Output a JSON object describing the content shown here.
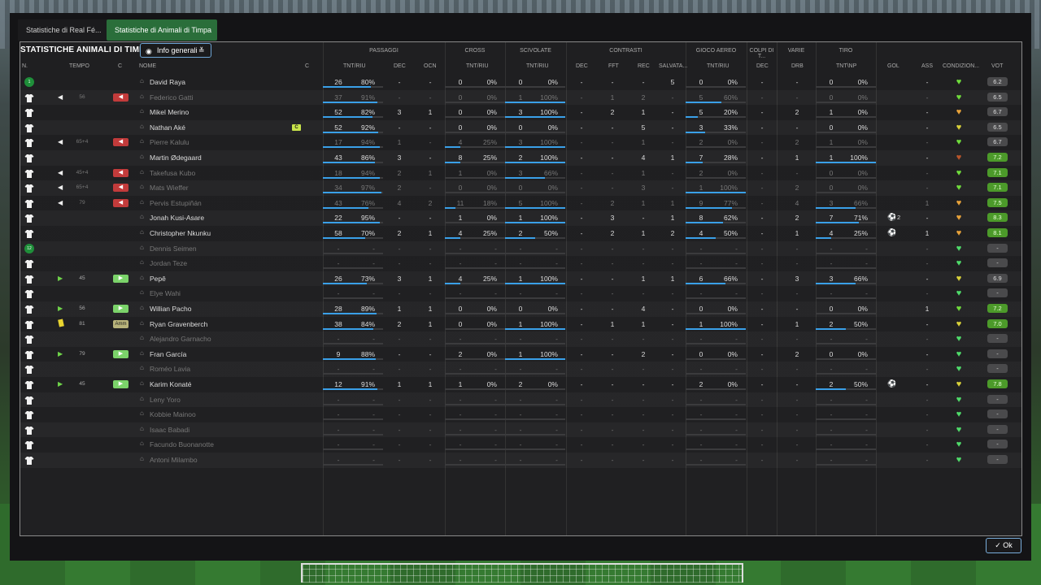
{
  "tabs": [
    {
      "label": "Statistiche di Real Fé..."
    },
    {
      "label": "Statistiche di Animali di Timpa"
    }
  ],
  "title": "STATISTICHE ANIMALI DI TIMPA",
  "view_dropdown": {
    "label": "Info generali"
  },
  "groups": {
    "passaggi": "PASSAGGI",
    "cross": "CROSS",
    "scivolate": "SCIVOLATE",
    "contrasti": "CONTRASTI",
    "gioco_aereo": "GIOCO AEREO",
    "colpi_di_testa": "COLPI DI T...",
    "varie": "VARIE",
    "tiro": "TIRO"
  },
  "columns": {
    "n": "N.",
    "tempo": "TEMPO",
    "c": "C",
    "nome": "NOME",
    "c2": "C",
    "pass_tnt": "TNT/RIU",
    "pass_dec": "DEC",
    "pass_ocn": "OCN",
    "cross_tnt": "TNT/RIU",
    "sciv_tnt": "TNT/RIU",
    "contr_dec": "DEC",
    "contr_fft": "FFT",
    "contr_rec": "REC",
    "contr_salv": "SALVATA...",
    "aereo_tnt": "TNT/RIU",
    "testa_dec": "DEC",
    "varie_drb": "DRB",
    "tiro_tnt": "TNT\\NP",
    "gol": "GOL",
    "ass": "ASS",
    "condizione": "CONDIZION...",
    "vot": "VOT"
  },
  "players": [
    {
      "num": "1",
      "gk": true,
      "tempo": "",
      "sub": "",
      "name": "David Raya",
      "dim": false,
      "cap": false,
      "p": "26",
      "pp": "80%",
      "pf": 0.8,
      "dec": "-",
      "ocn": "-",
      "cr": "0",
      "crp": "0%",
      "crf": 0,
      "sc": "0",
      "scp": "0%",
      "scf": 0,
      "cd": "-",
      "cf": "-",
      "cr2": "-",
      "cs": "5",
      "ae": "0",
      "aep": "0%",
      "aef": 0,
      "td": "-",
      "drb": "-",
      "ti": "0",
      "tip": "0%",
      "tif": 0,
      "gol": "",
      "golx": "",
      "ass": "-",
      "heart": "#6fdc3c",
      "vot": "6.2",
      "votg": false
    },
    {
      "num": "",
      "gk": false,
      "tempo": "56",
      "sub": "out",
      "name": "Federico Gatti",
      "dim": true,
      "cap": false,
      "p": "37",
      "pp": "91%",
      "pf": 0.91,
      "dec": "-",
      "ocn": "-",
      "cr": "0",
      "crp": "0%",
      "crf": 0,
      "sc": "1",
      "scp": "100%",
      "scf": 1,
      "cd": "-",
      "cf": "1",
      "cr2": "2",
      "cs": "-",
      "ae": "5",
      "aep": "60%",
      "aef": 0.6,
      "td": "-",
      "drb": "-",
      "ti": "0",
      "tip": "0%",
      "tif": 0,
      "gol": "",
      "golx": "",
      "ass": "-",
      "heart": "#6fdc3c",
      "vot": "6.5",
      "votg": false
    },
    {
      "num": "",
      "gk": false,
      "tempo": "",
      "sub": "",
      "name": "Mikel Merino",
      "dim": false,
      "cap": false,
      "p": "52",
      "pp": "82%",
      "pf": 0.82,
      "dec": "3",
      "ocn": "1",
      "cr": "0",
      "crp": "0%",
      "crf": 0,
      "sc": "3",
      "scp": "100%",
      "scf": 1,
      "cd": "-",
      "cf": "2",
      "cr2": "1",
      "cs": "-",
      "ae": "5",
      "aep": "20%",
      "aef": 0.2,
      "td": "-",
      "drb": "2",
      "ti": "1",
      "tip": "0%",
      "tif": 0,
      "gol": "",
      "golx": "",
      "ass": "-",
      "heart": "#e8a23a",
      "vot": "6.7",
      "votg": false
    },
    {
      "num": "",
      "gk": false,
      "tempo": "",
      "sub": "",
      "name": "Nathan Aké",
      "dim": false,
      "cap": true,
      "p": "52",
      "pp": "92%",
      "pf": 0.92,
      "dec": "-",
      "ocn": "-",
      "cr": "0",
      "crp": "0%",
      "crf": 0,
      "sc": "0",
      "scp": "0%",
      "scf": 0,
      "cd": "-",
      "cf": "-",
      "cr2": "5",
      "cs": "-",
      "ae": "3",
      "aep": "33%",
      "aef": 0.33,
      "td": "-",
      "drb": "-",
      "ti": "0",
      "tip": "0%",
      "tif": 0,
      "gol": "",
      "golx": "",
      "ass": "-",
      "heart": "#d9d23a",
      "vot": "6.5",
      "votg": false
    },
    {
      "num": "",
      "gk": false,
      "tempo": "65+4",
      "sub": "out",
      "name": "Pierre Kalulu",
      "dim": true,
      "cap": false,
      "p": "17",
      "pp": "94%",
      "pf": 0.94,
      "dec": "1",
      "ocn": "-",
      "cr": "4",
      "crp": "25%",
      "crf": 0.25,
      "sc": "3",
      "scp": "100%",
      "scf": 1,
      "cd": "-",
      "cf": "-",
      "cr2": "1",
      "cs": "-",
      "ae": "2",
      "aep": "0%",
      "aef": 0,
      "td": "-",
      "drb": "2",
      "ti": "1",
      "tip": "0%",
      "tif": 0,
      "gol": "",
      "golx": "",
      "ass": "-",
      "heart": "#6fdc3c",
      "vot": "6.7",
      "votg": false
    },
    {
      "num": "",
      "gk": false,
      "tempo": "",
      "sub": "",
      "name": "Martin Ødegaard",
      "dim": false,
      "cap": false,
      "p": "43",
      "pp": "86%",
      "pf": 0.86,
      "dec": "3",
      "ocn": "-",
      "cr": "8",
      "crp": "25%",
      "crf": 0.25,
      "sc": "2",
      "scp": "100%",
      "scf": 1,
      "cd": "-",
      "cf": "-",
      "cr2": "4",
      "cs": "1",
      "ae": "7",
      "aep": "28%",
      "aef": 0.28,
      "td": "-",
      "drb": "1",
      "ti": "1",
      "tip": "100%",
      "tif": 1,
      "gol": "",
      "golx": "",
      "ass": "-",
      "heart": "#b9552a",
      "vot": "7.2",
      "votg": true
    },
    {
      "num": "",
      "gk": false,
      "tempo": "45+4",
      "sub": "out",
      "name": "Takefusa Kubo",
      "dim": true,
      "cap": false,
      "p": "18",
      "pp": "94%",
      "pf": 0.94,
      "dec": "2",
      "ocn": "1",
      "cr": "1",
      "crp": "0%",
      "crf": 0,
      "sc": "3",
      "scp": "66%",
      "scf": 0.66,
      "cd": "-",
      "cf": "-",
      "cr2": "1",
      "cs": "-",
      "ae": "2",
      "aep": "0%",
      "aef": 0,
      "td": "-",
      "drb": "-",
      "ti": "0",
      "tip": "0%",
      "tif": 0,
      "gol": "",
      "golx": "",
      "ass": "-",
      "heart": "#6fdc3c",
      "vot": "7.1",
      "votg": true
    },
    {
      "num": "",
      "gk": false,
      "tempo": "65+4",
      "sub": "out",
      "name": "Mats Wieffer",
      "dim": true,
      "cap": false,
      "p": "34",
      "pp": "97%",
      "pf": 0.97,
      "dec": "2",
      "ocn": "-",
      "cr": "0",
      "crp": "0%",
      "crf": 0,
      "sc": "0",
      "scp": "0%",
      "scf": 0,
      "cd": "-",
      "cf": "-",
      "cr2": "3",
      "cs": "-",
      "ae": "1",
      "aep": "100%",
      "aef": 1,
      "td": "-",
      "drb": "2",
      "ti": "0",
      "tip": "0%",
      "tif": 0,
      "gol": "",
      "golx": "",
      "ass": "-",
      "heart": "#6fdc3c",
      "vot": "7.1",
      "votg": true
    },
    {
      "num": "",
      "gk": false,
      "tempo": "79",
      "sub": "out",
      "name": "Pervis Estupiñán",
      "dim": true,
      "cap": false,
      "p": "43",
      "pp": "76%",
      "pf": 0.76,
      "dec": "4",
      "ocn": "2",
      "cr": "11",
      "crp": "18%",
      "crf": 0.18,
      "sc": "5",
      "scp": "100%",
      "scf": 1,
      "cd": "-",
      "cf": "2",
      "cr2": "1",
      "cs": "1",
      "ae": "9",
      "aep": "77%",
      "aef": 0.77,
      "td": "-",
      "drb": "4",
      "ti": "3",
      "tip": "66%",
      "tif": 0.66,
      "gol": "",
      "golx": "",
      "ass": "1",
      "heart": "#e8a23a",
      "vot": "7.5",
      "votg": true
    },
    {
      "num": "",
      "gk": false,
      "tempo": "",
      "sub": "",
      "name": "Jonah Kusi-Asare",
      "dim": false,
      "cap": false,
      "p": "22",
      "pp": "95%",
      "pf": 0.95,
      "dec": "-",
      "ocn": "-",
      "cr": "1",
      "crp": "0%",
      "crf": 0,
      "sc": "1",
      "scp": "100%",
      "scf": 1,
      "cd": "-",
      "cf": "3",
      "cr2": "-",
      "cs": "1",
      "ae": "8",
      "aep": "62%",
      "aef": 0.62,
      "td": "-",
      "drb": "2",
      "ti": "7",
      "tip": "71%",
      "tif": 0.71,
      "gol": "ball",
      "golx": "2",
      "ass": "-",
      "heart": "#e8a23a",
      "vot": "8.3",
      "votg": true
    },
    {
      "num": "",
      "gk": false,
      "tempo": "",
      "sub": "",
      "name": "Christopher Nkunku",
      "dim": false,
      "cap": false,
      "p": "58",
      "pp": "70%",
      "pf": 0.7,
      "dec": "2",
      "ocn": "1",
      "cr": "4",
      "crp": "25%",
      "crf": 0.25,
      "sc": "2",
      "scp": "50%",
      "scf": 0.5,
      "cd": "-",
      "cf": "2",
      "cr2": "1",
      "cs": "2",
      "ae": "4",
      "aep": "50%",
      "aef": 0.5,
      "td": "-",
      "drb": "1",
      "ti": "4",
      "tip": "25%",
      "tif": 0.25,
      "gol": "ball",
      "golx": "",
      "ass": "1",
      "heart": "#e8a23a",
      "vot": "8.1",
      "votg": true
    },
    {
      "num": "12",
      "gk": true,
      "tempo": "",
      "sub": "",
      "name": "Dennis Seimen",
      "dim": true,
      "cap": false,
      "p": "-",
      "pp": "-",
      "pf": 0,
      "dec": "-",
      "ocn": "-",
      "cr": "-",
      "crp": "-",
      "crf": 0,
      "sc": "-",
      "scp": "-",
      "scf": 0,
      "cd": "-",
      "cf": "-",
      "cr2": "-",
      "cs": "-",
      "ae": "-",
      "aep": "-",
      "aef": 0,
      "td": "-",
      "drb": "-",
      "ti": "-",
      "tip": "-",
      "tif": 0,
      "gol": "",
      "golx": "",
      "ass": "-",
      "heart": "#4fdc6a",
      "vot": "-",
      "votg": false
    },
    {
      "num": "",
      "gk": false,
      "tempo": "",
      "sub": "",
      "name": "Jordan Teze",
      "dim": true,
      "cap": false,
      "p": "-",
      "pp": "-",
      "pf": 0,
      "dec": "-",
      "ocn": "-",
      "cr": "-",
      "crp": "-",
      "crf": 0,
      "sc": "-",
      "scp": "-",
      "scf": 0,
      "cd": "-",
      "cf": "-",
      "cr2": "-",
      "cs": "-",
      "ae": "-",
      "aep": "-",
      "aef": 0,
      "td": "-",
      "drb": "-",
      "ti": "-",
      "tip": "-",
      "tif": 0,
      "gol": "",
      "golx": "",
      "ass": "-",
      "heart": "#4fdc6a",
      "vot": "-",
      "votg": false
    },
    {
      "num": "",
      "gk": false,
      "tempo": "45",
      "sub": "in",
      "name": "Pepê",
      "dim": false,
      "cap": false,
      "p": "26",
      "pp": "73%",
      "pf": 0.73,
      "dec": "3",
      "ocn": "1",
      "cr": "4",
      "crp": "25%",
      "crf": 0.25,
      "sc": "1",
      "scp": "100%",
      "scf": 1,
      "cd": "-",
      "cf": "-",
      "cr2": "1",
      "cs": "1",
      "ae": "6",
      "aep": "66%",
      "aef": 0.66,
      "td": "-",
      "drb": "3",
      "ti": "3",
      "tip": "66%",
      "tif": 0.66,
      "gol": "",
      "golx": "",
      "ass": "-",
      "heart": "#d9d23a",
      "vot": "6.9",
      "votg": false
    },
    {
      "num": "",
      "gk": false,
      "tempo": "",
      "sub": "",
      "name": "Elye Wahi",
      "dim": true,
      "cap": false,
      "p": "-",
      "pp": "-",
      "pf": 0,
      "dec": "-",
      "ocn": "-",
      "cr": "-",
      "crp": "-",
      "crf": 0,
      "sc": "-",
      "scp": "-",
      "scf": 0,
      "cd": "-",
      "cf": "-",
      "cr2": "-",
      "cs": "-",
      "ae": "-",
      "aep": "-",
      "aef": 0,
      "td": "-",
      "drb": "-",
      "ti": "-",
      "tip": "-",
      "tif": 0,
      "gol": "",
      "golx": "",
      "ass": "-",
      "heart": "#4fdc6a",
      "vot": "-",
      "votg": false
    },
    {
      "num": "",
      "gk": false,
      "tempo": "56",
      "sub": "in",
      "name": "Willian Pacho",
      "dim": false,
      "cap": false,
      "p": "28",
      "pp": "89%",
      "pf": 0.89,
      "dec": "1",
      "ocn": "1",
      "cr": "0",
      "crp": "0%",
      "crf": 0,
      "sc": "0",
      "scp": "0%",
      "scf": 0,
      "cd": "-",
      "cf": "-",
      "cr2": "4",
      "cs": "-",
      "ae": "0",
      "aep": "0%",
      "aef": 0,
      "td": "-",
      "drb": "-",
      "ti": "0",
      "tip": "0%",
      "tif": 0,
      "gol": "",
      "golx": "",
      "ass": "1",
      "heart": "#6fdc3c",
      "vot": "7.2",
      "votg": true
    },
    {
      "num": "",
      "gk": false,
      "tempo": "81",
      "sub": "am",
      "yc": true,
      "name": "Ryan Gravenberch",
      "dim": false,
      "cap": false,
      "p": "38",
      "pp": "84%",
      "pf": 0.84,
      "dec": "2",
      "ocn": "1",
      "cr": "0",
      "crp": "0%",
      "crf": 0,
      "sc": "1",
      "scp": "100%",
      "scf": 1,
      "cd": "-",
      "cf": "1",
      "cr2": "1",
      "cs": "-",
      "ae": "1",
      "aep": "100%",
      "aef": 1,
      "td": "-",
      "drb": "1",
      "ti": "2",
      "tip": "50%",
      "tif": 0.5,
      "gol": "",
      "golx": "",
      "ass": "-",
      "heart": "#d9d23a",
      "vot": "7.0",
      "votg": true
    },
    {
      "num": "",
      "gk": false,
      "tempo": "",
      "sub": "",
      "name": "Alejandro Garnacho",
      "dim": true,
      "cap": false,
      "p": "-",
      "pp": "-",
      "pf": 0,
      "dec": "-",
      "ocn": "-",
      "cr": "-",
      "crp": "-",
      "crf": 0,
      "sc": "-",
      "scp": "-",
      "scf": 0,
      "cd": "-",
      "cf": "-",
      "cr2": "-",
      "cs": "-",
      "ae": "-",
      "aep": "-",
      "aef": 0,
      "td": "-",
      "drb": "-",
      "ti": "-",
      "tip": "-",
      "tif": 0,
      "gol": "",
      "golx": "",
      "ass": "-",
      "heart": "#4fdc6a",
      "vot": "-",
      "votg": false
    },
    {
      "num": "",
      "gk": false,
      "tempo": "79",
      "sub": "in",
      "name": "Fran García",
      "dim": false,
      "cap": false,
      "p": "9",
      "pp": "88%",
      "pf": 0.88,
      "dec": "-",
      "ocn": "-",
      "cr": "2",
      "crp": "0%",
      "crf": 0,
      "sc": "1",
      "scp": "100%",
      "scf": 1,
      "cd": "-",
      "cf": "-",
      "cr2": "2",
      "cs": "-",
      "ae": "0",
      "aep": "0%",
      "aef": 0,
      "td": "-",
      "drb": "2",
      "ti": "0",
      "tip": "0%",
      "tif": 0,
      "gol": "",
      "golx": "",
      "ass": "-",
      "heart": "#4fdc6a",
      "vot": "-",
      "votg": false
    },
    {
      "num": "",
      "gk": false,
      "tempo": "",
      "sub": "",
      "name": "Roméo Lavia",
      "dim": true,
      "cap": false,
      "p": "-",
      "pp": "-",
      "pf": 0,
      "dec": "-",
      "ocn": "-",
      "cr": "-",
      "crp": "-",
      "crf": 0,
      "sc": "-",
      "scp": "-",
      "scf": 0,
      "cd": "-",
      "cf": "-",
      "cr2": "-",
      "cs": "-",
      "ae": "-",
      "aep": "-",
      "aef": 0,
      "td": "-",
      "drb": "-",
      "ti": "-",
      "tip": "-",
      "tif": 0,
      "gol": "",
      "golx": "",
      "ass": "-",
      "heart": "#4fdc6a",
      "vot": "-",
      "votg": false
    },
    {
      "num": "",
      "gk": false,
      "tempo": "45",
      "sub": "in",
      "name": "Karim Konaté",
      "dim": false,
      "cap": false,
      "p": "12",
      "pp": "91%",
      "pf": 0.91,
      "dec": "1",
      "ocn": "1",
      "cr": "1",
      "crp": "0%",
      "crf": 0,
      "sc": "2",
      "scp": "0%",
      "scf": 0,
      "cd": "-",
      "cf": "-",
      "cr2": "-",
      "cs": "-",
      "ae": "2",
      "aep": "0%",
      "aef": 0,
      "td": "-",
      "drb": "-",
      "ti": "2",
      "tip": "50%",
      "tif": 0.5,
      "gol": "ball",
      "golx": "",
      "ass": "-",
      "heart": "#d9d23a",
      "vot": "7.8",
      "votg": true
    },
    {
      "num": "",
      "gk": false,
      "tempo": "",
      "sub": "",
      "name": "Leny Yoro",
      "dim": true,
      "cap": false,
      "p": "-",
      "pp": "-",
      "pf": 0,
      "dec": "-",
      "ocn": "-",
      "cr": "-",
      "crp": "-",
      "crf": 0,
      "sc": "-",
      "scp": "-",
      "scf": 0,
      "cd": "-",
      "cf": "-",
      "cr2": "-",
      "cs": "-",
      "ae": "-",
      "aep": "-",
      "aef": 0,
      "td": "-",
      "drb": "-",
      "ti": "-",
      "tip": "-",
      "tif": 0,
      "gol": "",
      "golx": "",
      "ass": "-",
      "heart": "#4fdc6a",
      "vot": "-",
      "votg": false
    },
    {
      "num": "",
      "gk": false,
      "tempo": "",
      "sub": "",
      "name": "Kobbie Mainoo",
      "dim": true,
      "cap": false,
      "p": "-",
      "pp": "-",
      "pf": 0,
      "dec": "-",
      "ocn": "-",
      "cr": "-",
      "crp": "-",
      "crf": 0,
      "sc": "-",
      "scp": "-",
      "scf": 0,
      "cd": "-",
      "cf": "-",
      "cr2": "-",
      "cs": "-",
      "ae": "-",
      "aep": "-",
      "aef": 0,
      "td": "-",
      "drb": "-",
      "ti": "-",
      "tip": "-",
      "tif": 0,
      "gol": "",
      "golx": "",
      "ass": "-",
      "heart": "#4fdc6a",
      "vot": "-",
      "votg": false
    },
    {
      "num": "",
      "gk": false,
      "tempo": "",
      "sub": "",
      "name": "Isaac Babadi",
      "dim": true,
      "cap": false,
      "p": "-",
      "pp": "-",
      "pf": 0,
      "dec": "-",
      "ocn": "-",
      "cr": "-",
      "crp": "-",
      "crf": 0,
      "sc": "-",
      "scp": "-",
      "scf": 0,
      "cd": "-",
      "cf": "-",
      "cr2": "-",
      "cs": "-",
      "ae": "-",
      "aep": "-",
      "aef": 0,
      "td": "-",
      "drb": "-",
      "ti": "-",
      "tip": "-",
      "tif": 0,
      "gol": "",
      "golx": "",
      "ass": "-",
      "heart": "#4fdc6a",
      "vot": "-",
      "votg": false
    },
    {
      "num": "",
      "gk": false,
      "tempo": "",
      "sub": "",
      "name": "Facundo Buonanotte",
      "dim": true,
      "cap": false,
      "p": "-",
      "pp": "-",
      "pf": 0,
      "dec": "-",
      "ocn": "-",
      "cr": "-",
      "crp": "-",
      "crf": 0,
      "sc": "-",
      "scp": "-",
      "scf": 0,
      "cd": "-",
      "cf": "-",
      "cr2": "-",
      "cs": "-",
      "ae": "-",
      "aep": "-",
      "aef": 0,
      "td": "-",
      "drb": "-",
      "ti": "-",
      "tip": "-",
      "tif": 0,
      "gol": "",
      "golx": "",
      "ass": "-",
      "heart": "#4fdc6a",
      "vot": "-",
      "votg": false
    },
    {
      "num": "",
      "gk": false,
      "tempo": "",
      "sub": "",
      "name": "Antoni Milambo",
      "dim": true,
      "cap": false,
      "p": "-",
      "pp": "-",
      "pf": 0,
      "dec": "-",
      "ocn": "-",
      "cr": "-",
      "crp": "-",
      "crf": 0,
      "sc": "-",
      "scp": "-",
      "scf": 0,
      "cd": "-",
      "cf": "-",
      "cr2": "-",
      "cs": "-",
      "ae": "-",
      "aep": "-",
      "aef": 0,
      "td": "-",
      "drb": "-",
      "ti": "-",
      "tip": "-",
      "tif": 0,
      "gol": "",
      "golx": "",
      "ass": "-",
      "heart": "#4fdc6a",
      "vot": "-",
      "votg": false
    }
  ],
  "cap_badge": "C",
  "sub_in_symbol": "▶",
  "sub_out_symbol": "◀",
  "sub_am_label": "Amm",
  "ok_button": {
    "label": "Ok"
  },
  "colors": {
    "accent_blue": "#3aa0e8",
    "tab_green": "#2a6e3a",
    "vote_green": "#4c9a2a"
  }
}
